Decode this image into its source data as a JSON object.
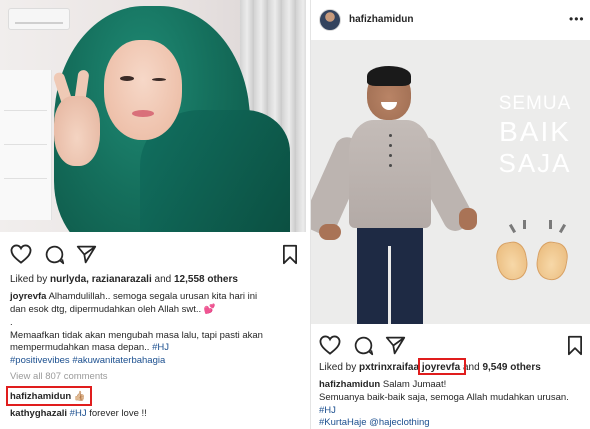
{
  "left_post": {
    "likes": {
      "prefix": "Liked by",
      "users": "nurlyda, razianarazali",
      "joiner": "and",
      "count": "12,558 others"
    },
    "caption": {
      "username": "joyrevfa",
      "line1": "Alhamdulillah.. semoga segala urusan kita hari ini",
      "line2": "dan esok dtg, dipermudahkan oleh Allah swt..",
      "emoji": "💕",
      "dot": ".",
      "line3": "Memaafkan tidak akan mengubah masa lalu, tapi pasti akan",
      "line4_text": "mempermudahkan masa depan..",
      "line4_tag": "#HJ",
      "line5_tag1": "#positivevibes",
      "line5_tag2": "#akuwanitaterbahagia"
    },
    "view_all": "View all 807 comments",
    "comments": [
      {
        "username": "hafizhamidun",
        "emoji": "👍🏼",
        "text": ""
      },
      {
        "username": "kathyghazali",
        "tag": "#HJ",
        "text": "forever love !!"
      }
    ]
  },
  "right_post": {
    "header": {
      "username": "hafizhamidun",
      "more": "•••"
    },
    "image_text": {
      "line1": "SEMUA",
      "line2": "BAIK",
      "line3": "SAJA"
    },
    "likes": {
      "prefix": "Liked by",
      "user1": "pxtrinxraifaa",
      "user2": "joyrevfa",
      "joiner": "and",
      "count": "9,549 others"
    },
    "caption": {
      "username": "hafizhamidun",
      "line1": "Salam Jumaat!",
      "line2": "Semuanya baik-baik saja, semoga Allah mudahkan urusan.",
      "tag1": "#HJ",
      "tag2": "#KurtaHaje",
      "mention": "@hajeclothing"
    }
  },
  "colors": {
    "highlight": "#e01d1d",
    "hashtag": "#1b4f8f",
    "muted": "#9a9a9a"
  },
  "icons": [
    "heart-icon",
    "comment-icon",
    "share-icon",
    "bookmark-icon",
    "more-icon"
  ]
}
